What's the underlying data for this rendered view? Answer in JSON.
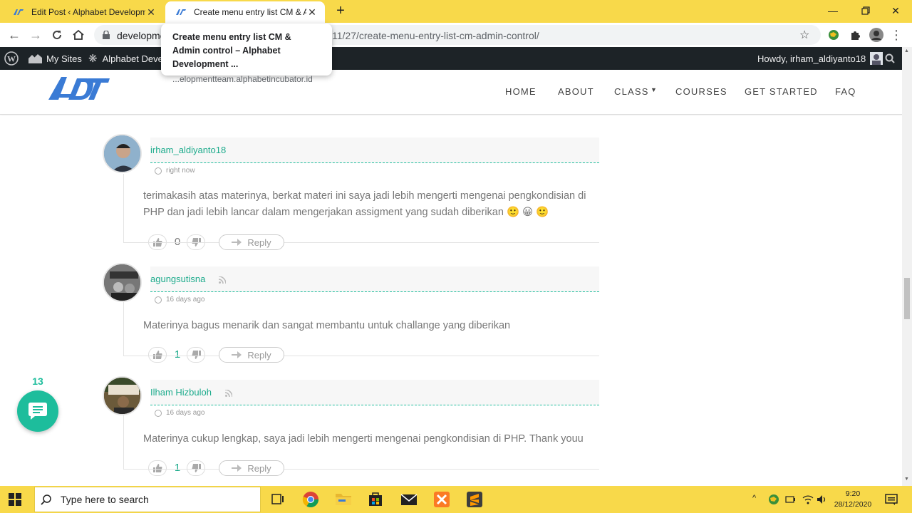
{
  "browser": {
    "tabs": [
      {
        "title": "Edit Post ‹ Alphabet Developmen",
        "active": false
      },
      {
        "title": "Create menu entry list CM & Adm",
        "active": true
      }
    ],
    "url_left": "developme",
    "url_right": "11/27/create-menu-entry-list-cm-admin-control/",
    "tooltip": {
      "title": "Create menu entry list CM & Admin control – Alphabet Development ...",
      "domain": "...elopmentteam.alphabetincubator.id"
    }
  },
  "adminbar": {
    "my_sites": "My Sites",
    "site_name": "Alphabet Deve",
    "howdy": "Howdy, irham_aldiyanto18"
  },
  "nav": {
    "items": [
      "HOME",
      "ABOUT",
      "CLASS",
      "COURSES",
      "GET STARTED",
      "FAQ"
    ]
  },
  "comments": [
    {
      "author": "irham_aldiyanto18",
      "time": "right now",
      "text": "terimakasih atas materinya, berkat materi ini saya jadi lebih mengerti mengenai pengkondisian di PHP dan jadi lebih lancar dalam mengerjakan assigment yang sudah diberikan 🙂 😀 🙂",
      "votes": "0",
      "reply": "Reply"
    },
    {
      "author": "agungsutisna",
      "time": "16 days ago",
      "text": "Materinya bagus menarik dan sangat membantu untuk challange yang diberikan",
      "votes": "1",
      "reply": "Reply"
    },
    {
      "author": "Ilham Hizbuloh",
      "time": "16 days ago",
      "text": "Materinya cukup lengkap, saya jadi lebih mengerti mengenai pengkondisian di PHP. Thank youu",
      "votes": "1",
      "reply": "Reply"
    }
  ],
  "bubble_count": "13",
  "taskbar": {
    "search_placeholder": "Type here to search",
    "time": "9:20",
    "date": "28/12/2020"
  },
  "colors": {
    "accent": "#1dbd9c",
    "tabstrip": "#f8d94a",
    "adminbar": "#1d2327"
  }
}
